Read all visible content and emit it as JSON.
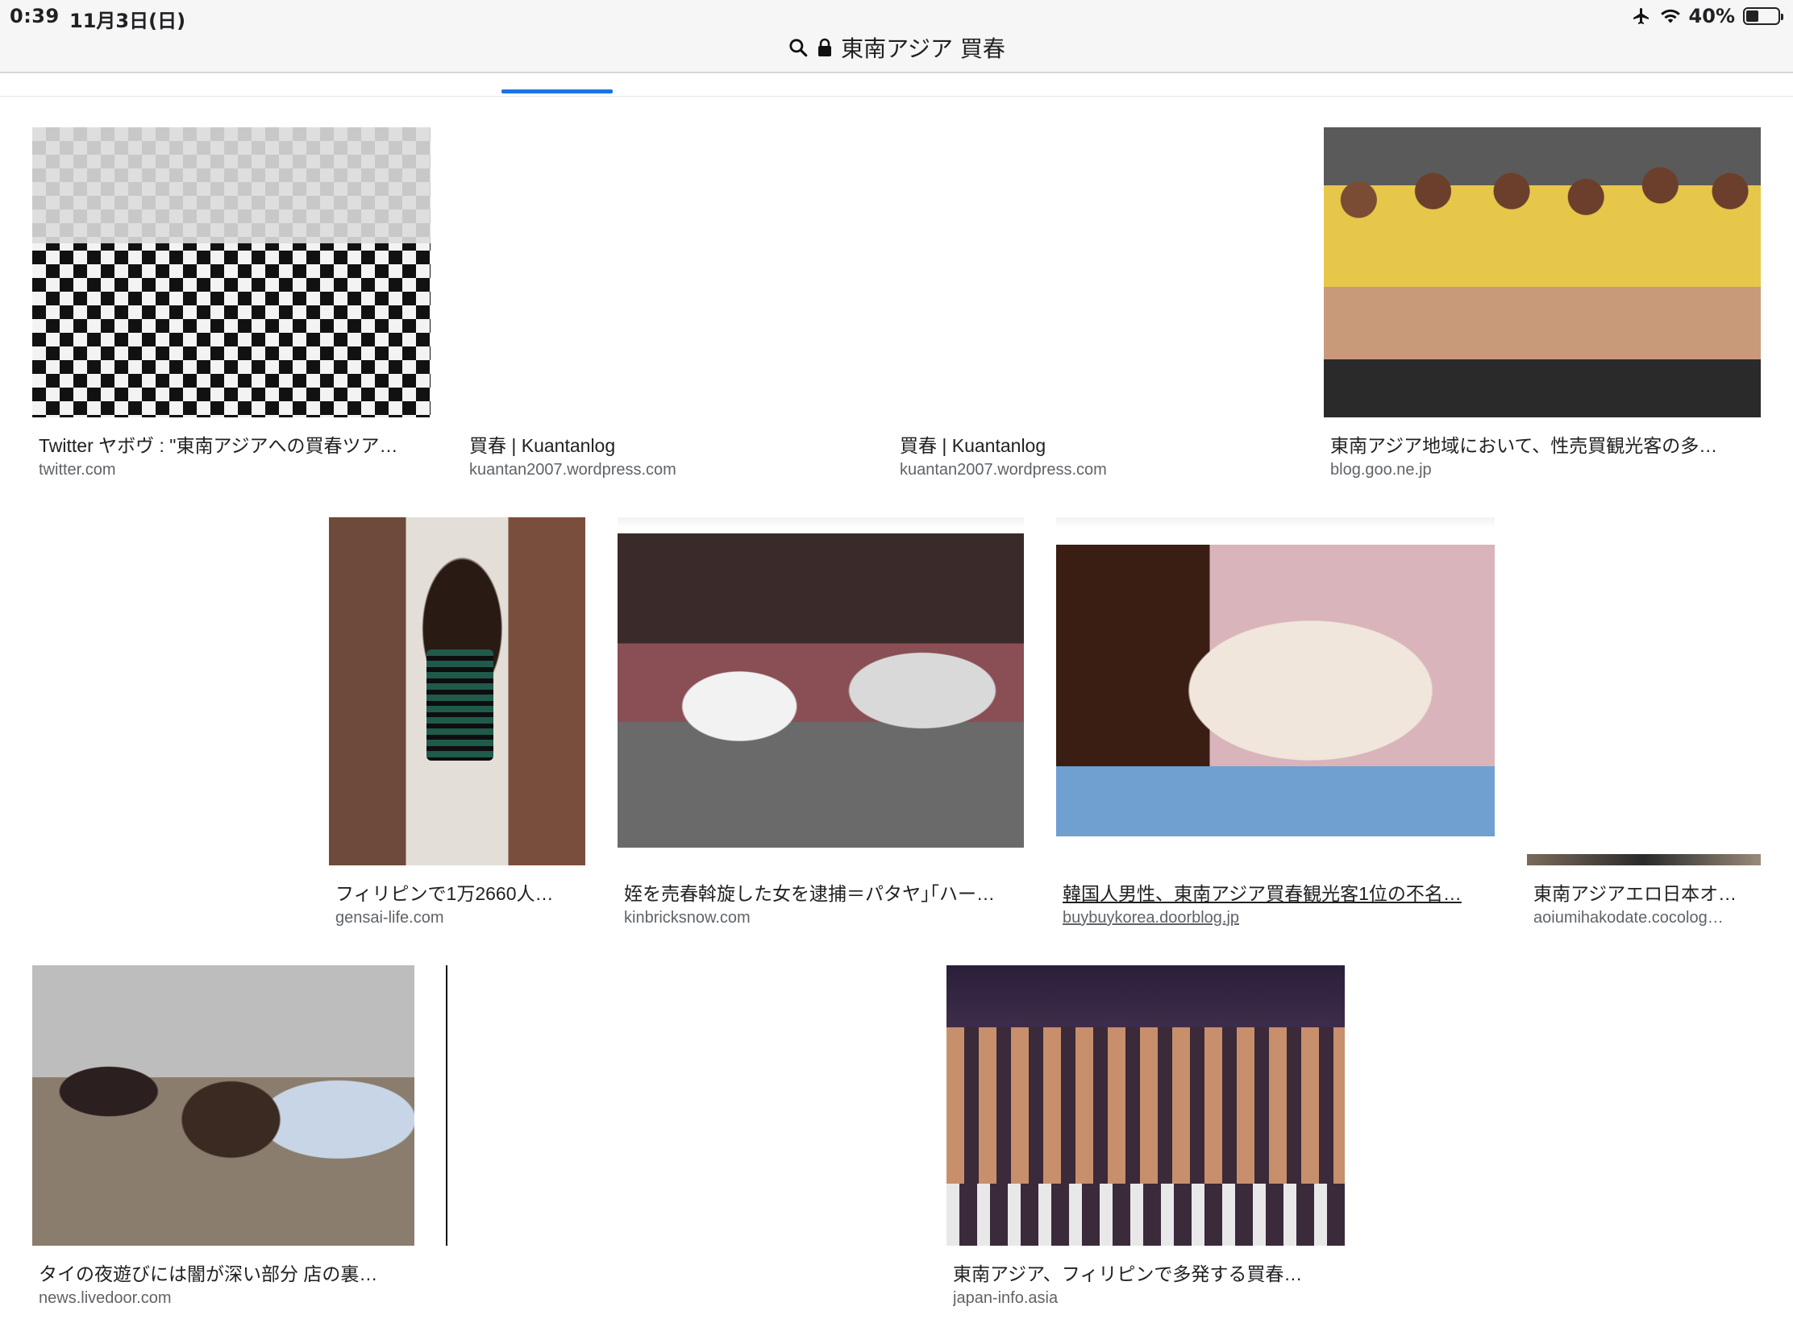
{
  "status_bar": {
    "time": "0:39",
    "date": "11月3日(日)",
    "battery_percent": "40%",
    "battery_level": 0.4
  },
  "url_bar": {
    "query": "東南アジア 買春"
  },
  "results": [
    {
      "caption": "Twitter ヤボヴ : \"東南アジアへの買春ツア…",
      "source": "twitter.com",
      "image": "checker"
    },
    {
      "caption": "買春 | Kuantanlog",
      "source": "kuantan2007.wordpress.com",
      "image": "blank"
    },
    {
      "caption": "買春 | Kuantanlog",
      "source": "kuantan2007.wordpress.com",
      "image": "blank"
    },
    {
      "caption": "東南アジア地域において、性売買観光客の多…",
      "source": "blog.goo.ne.jp",
      "image": "yellow"
    },
    {
      "caption": "フィリピンで1万2660人…",
      "source": "gensai-life.com",
      "image": "girl"
    },
    {
      "caption": "姪を売春斡旋した女を逮捕＝パタヤ｣｢ハー…",
      "source": "kinbricksnow.com",
      "image": "street"
    },
    {
      "caption": "韓国人男性、東南アジア買春観光客1位の不名…",
      "source": "buybuykorea.doorblog.jp",
      "image": "dress"
    },
    {
      "caption": "東南アジアエロ日本オ…",
      "source": "aoiumihakodate.cocolog…",
      "image": "blank-strip"
    },
    {
      "caption": "タイの夜遊びには闇が深い部分 店の裏…",
      "source": "news.livedoor.com",
      "image": "karaoke"
    },
    {
      "caption": "東南アジア、フィリピンで多発する買春…",
      "source": "japan-info.asia",
      "image": "club"
    }
  ],
  "colors": {
    "accent": "#1a73e8",
    "caption_text": "#202124",
    "source_text": "#5f6368"
  }
}
